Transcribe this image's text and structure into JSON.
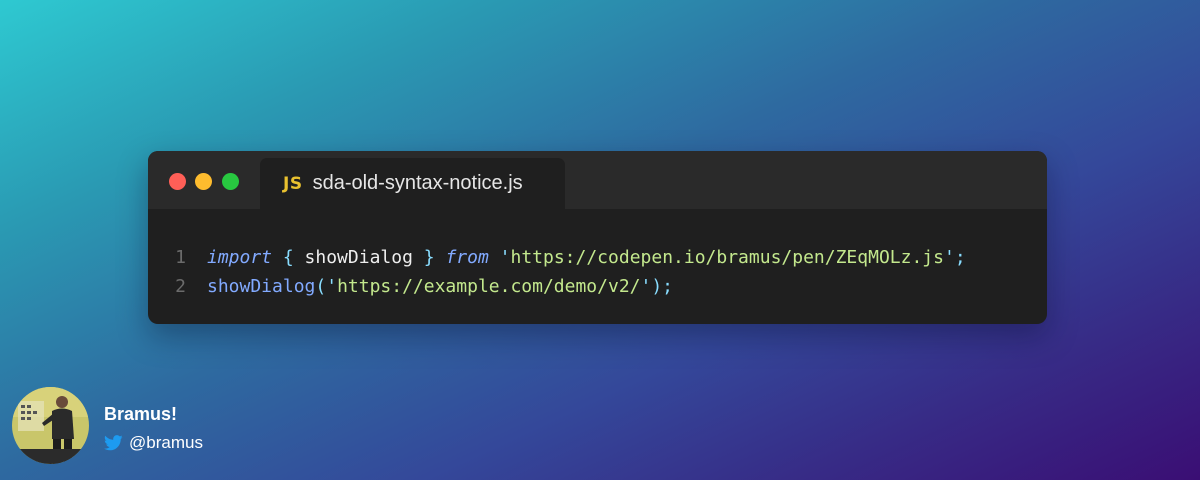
{
  "editor": {
    "tab": {
      "icon_label": "JS",
      "filename": "sda-old-syntax-notice.js"
    },
    "code_lines": [
      {
        "number": "1",
        "tokens": [
          {
            "kind": "kw",
            "text": "import"
          },
          {
            "kind": "punc",
            "text": " { "
          },
          {
            "kind": "plain",
            "text": "showDialog"
          },
          {
            "kind": "punc",
            "text": " } "
          },
          {
            "kind": "kw",
            "text": "from"
          },
          {
            "kind": "plain",
            "text": " "
          },
          {
            "kind": "punc",
            "text": "'"
          },
          {
            "kind": "str",
            "text": "https://codepen.io/bramus/pen/ZEqMOLz.js"
          },
          {
            "kind": "punc",
            "text": "'"
          },
          {
            "kind": "punc",
            "text": ";"
          }
        ]
      },
      {
        "number": "2",
        "tokens": [
          {
            "kind": "fn",
            "text": "showDialog"
          },
          {
            "kind": "punc",
            "text": "('"
          },
          {
            "kind": "str",
            "text": "https://example.com/demo/v2/"
          },
          {
            "kind": "punc",
            "text": "');"
          }
        ]
      }
    ],
    "traffic_lights": {
      "close": "#ff5f57",
      "minimize": "#febc2e",
      "maximize": "#28c840"
    }
  },
  "author": {
    "name": "Bramus!",
    "handle": "@bramus",
    "platform_icon": "twitter-bird-icon"
  },
  "colors": {
    "background_start": "#2ec9d1",
    "background_end": "#3a0e74",
    "window_bg": "#1f1f1f",
    "titlebar_bg": "#2a2a2a",
    "js_badge": "#e9c12f",
    "twitter_blue": "#1d9bf0"
  }
}
